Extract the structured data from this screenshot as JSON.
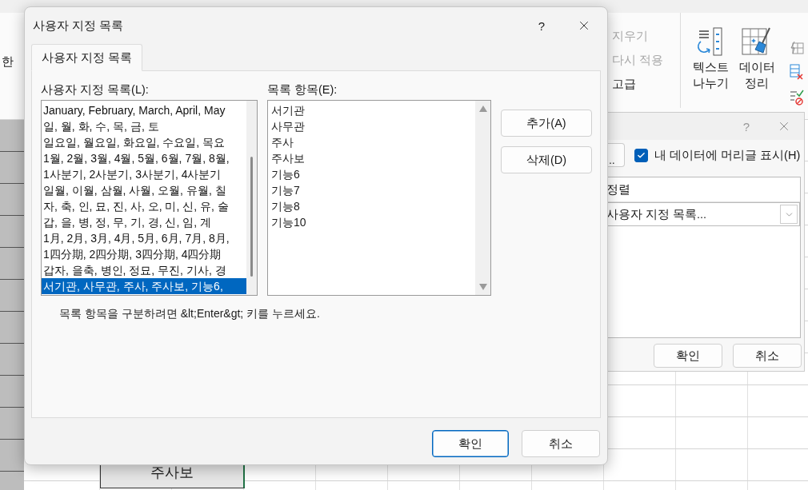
{
  "ribbon": {
    "left_fragment": "한",
    "commands": [
      {
        "label": "지우기",
        "disabled": true
      },
      {
        "label": "다시 적용",
        "disabled": true
      },
      {
        "label": "고급",
        "disabled": false
      }
    ],
    "tools": [
      {
        "kind": "text-to-columns",
        "label": "텍스트 나누기"
      },
      {
        "kind": "data-cleanup",
        "label": "데이터 정리"
      }
    ]
  },
  "sheet": {
    "cell": "주사보"
  },
  "sort_dialog": {
    "help": "?",
    "button_fragment": "…",
    "header_checkbox": {
      "label": "내 데이터에 머리글 표시(H)",
      "checked": true
    },
    "column_header": "정렬",
    "order_select": "사용자 지정 목록...",
    "buttons": [
      "확인",
      "취소"
    ]
  },
  "dialog": {
    "title": "사용자 지정 목록",
    "help": "?",
    "tabs": [
      {
        "label": "사용자 지정 목록",
        "selected": true
      }
    ],
    "lists_label": "사용자 지정 목록(L):",
    "lists": [
      {
        "text": "January, February, March, April, May",
        "selected": false
      },
      {
        "text": "일, 월, 화, 수, 목, 금, 토",
        "selected": false
      },
      {
        "text": "일요일, 월요일, 화요일, 수요일, 목요",
        "selected": false
      },
      {
        "text": "1월, 2월, 3월, 4월, 5월, 6월, 7월, 8월,",
        "selected": false
      },
      {
        "text": "1사분기, 2사분기, 3사분기, 4사분기",
        "selected": false
      },
      {
        "text": "일월, 이월, 삼월, 사월, 오월, 유월, 칠",
        "selected": false
      },
      {
        "text": "자, 축, 인, 묘, 진, 사, 오, 미, 신, 유, 술",
        "selected": false
      },
      {
        "text": "갑, 을, 병, 정, 무, 기, 경, 신, 임, 계",
        "selected": false
      },
      {
        "text": "1月, 2月, 3月, 4月, 5月, 6月, 7月, 8月,",
        "selected": false
      },
      {
        "text": "1四分期, 2四分期, 3四分期, 4四分期",
        "selected": false
      },
      {
        "text": "갑자, 을축, 병인, 정묘, 무진, 기사, 경",
        "selected": false
      },
      {
        "text": "서기관, 사무관, 주사, 주사보, 기능6,",
        "selected": true
      }
    ],
    "entries_label": "목록 항목(E):",
    "entries": [
      "서기관",
      "사무관",
      "주사",
      "주사보",
      "기능6",
      "기능7",
      "기능8",
      "기능10"
    ],
    "side_buttons": [
      "추가(A)",
      "삭제(D)"
    ],
    "hint": "목록 항목을 구분하려면 &lt;Enter&gt; 키를 누르세요.",
    "footer_buttons": [
      {
        "label": "확인",
        "default": true
      },
      {
        "label": "취소",
        "default": false
      }
    ]
  }
}
